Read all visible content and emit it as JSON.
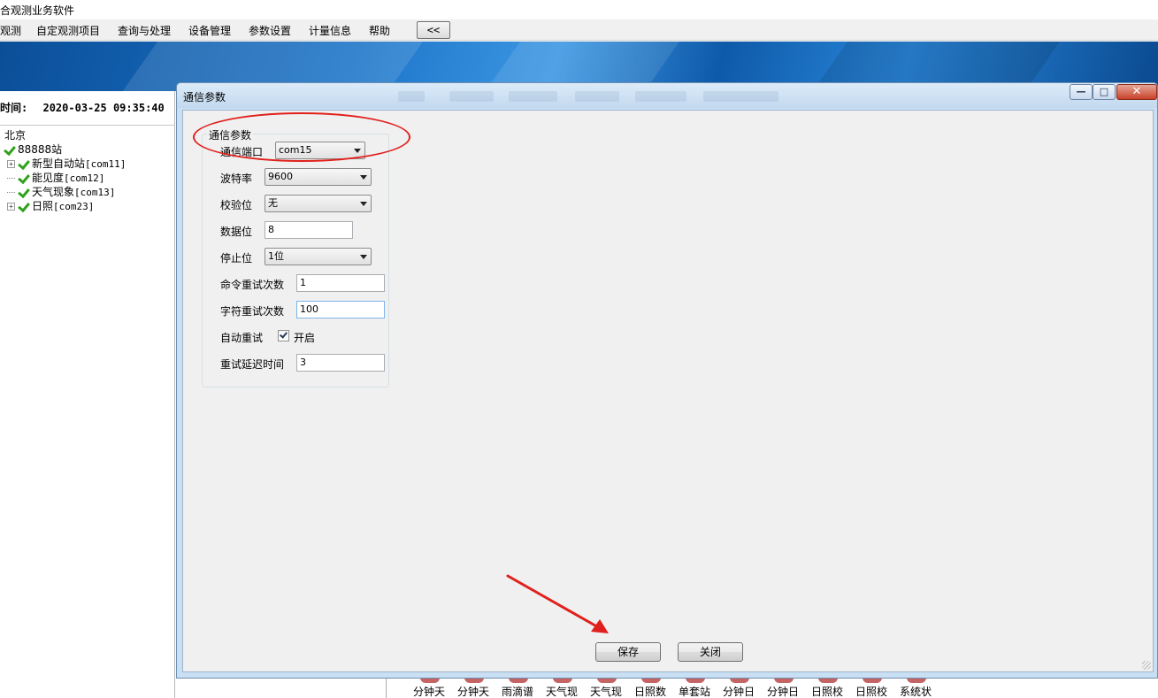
{
  "app": {
    "title": "合观测业务软件"
  },
  "menu": {
    "items": [
      "观测",
      "自定观测项目",
      "查询与处理",
      "设备管理",
      "参数设置",
      "计量信息",
      "帮助"
    ],
    "collapse_label": "<<"
  },
  "left_panel": {
    "time_label": "时间:",
    "time_value": "2020-03-25 09:35:40",
    "tree": {
      "root": "北京",
      "station": "88888站",
      "devices": [
        {
          "name": "新型自动站",
          "port": "[com11]",
          "expandable": true
        },
        {
          "name": "能见度",
          "port": "[com12]",
          "expandable": false
        },
        {
          "name": "天气现象",
          "port": "[com13]",
          "expandable": false
        },
        {
          "name": "日照",
          "port": "[com23]",
          "expandable": true
        }
      ]
    }
  },
  "bottom_bar": {
    "items": [
      "分钟天",
      "分钟天",
      "雨滴谱",
      "天气现",
      "天气现",
      "日照数",
      "单套站",
      "分钟日",
      "分钟日",
      "日照校",
      "日照校",
      "系统状"
    ]
  },
  "dialog": {
    "title": "通信参数",
    "window_controls": {
      "minimize": "—",
      "maximize": "□",
      "close": "✕"
    },
    "group": {
      "legend": "通信参数",
      "port_label": "通信端口",
      "port_value": "com15",
      "baud_label": "波特率",
      "baud_value": "9600",
      "parity_label": "校验位",
      "parity_value": "无",
      "databits_label": "数据位",
      "databits_value": "8",
      "stopbits_label": "停止位",
      "stopbits_value": "1位",
      "cmd_retry_label": "命令重试次数",
      "cmd_retry_value": "1",
      "char_retry_label": "字符重试次数",
      "char_retry_value": "100",
      "auto_retry_label": "自动重试",
      "auto_retry_checked": true,
      "auto_retry_option": "开启",
      "retry_delay_label": "重试延迟时间",
      "retry_delay_value": "3"
    },
    "buttons": {
      "save": "保存",
      "close": "关闭"
    }
  },
  "colors": {
    "annotation_red": "#e0201c",
    "check_green": "#2ea21a",
    "banner_blue": "#1b73c7"
  }
}
